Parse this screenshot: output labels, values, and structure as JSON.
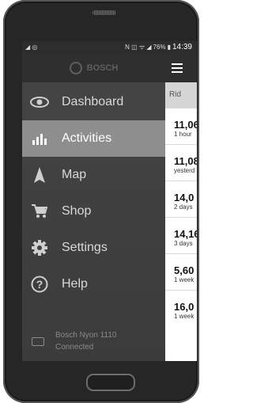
{
  "status_bar": {
    "battery": "76%",
    "time": "14:39"
  },
  "drawer": {
    "brand": "BOSCH",
    "items": [
      {
        "label": "Dashboard",
        "icon": "eye-icon",
        "active": false
      },
      {
        "label": "Activities",
        "icon": "bar-chart-icon",
        "active": true
      },
      {
        "label": "Map",
        "icon": "navigation-arrow-icon",
        "active": false
      },
      {
        "label": "Shop",
        "icon": "cart-icon",
        "active": false
      },
      {
        "label": "Settings",
        "icon": "gear-icon",
        "active": false
      },
      {
        "label": "Help",
        "icon": "help-icon",
        "active": false
      }
    ],
    "device": {
      "name": "Bosch Nyon 1110",
      "status": "Connected"
    }
  },
  "list": {
    "header": "Rid",
    "rows": [
      {
        "value": "11,06",
        "when": "1 hour"
      },
      {
        "value": "11,08",
        "when": "yesterd"
      },
      {
        "value": "14,0",
        "when": "2 days"
      },
      {
        "value": "14,16",
        "when": "3 days"
      },
      {
        "value": "5,60",
        "when": "1 week"
      },
      {
        "value": "16,0",
        "when": "1 week"
      }
    ]
  }
}
